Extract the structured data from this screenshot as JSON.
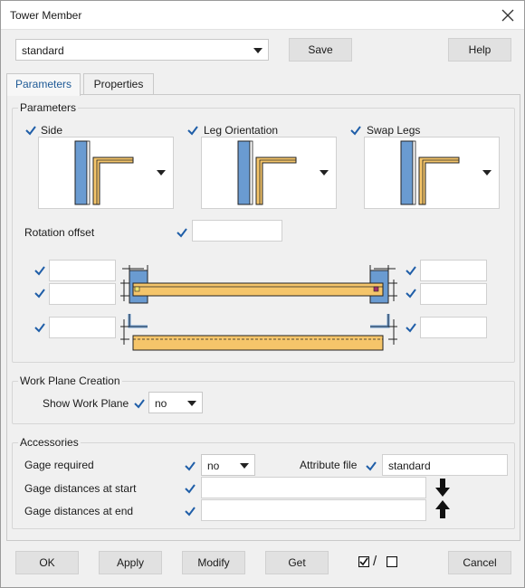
{
  "window": {
    "title": "Tower Member"
  },
  "toolbar": {
    "preset_value": "standard",
    "save_label": "Save",
    "help_label": "Help"
  },
  "tabs": [
    {
      "label": "Parameters"
    },
    {
      "label": "Properties"
    }
  ],
  "parameters": {
    "group_label": "Parameters",
    "side_label": "Side",
    "leg_orientation_label": "Leg Orientation",
    "swap_legs_label": "Swap Legs",
    "rotation_offset_label": "Rotation offset",
    "rotation_offset_value": ""
  },
  "work_plane": {
    "group_label": "Work Plane Creation",
    "show_label": "Show Work Plane",
    "show_value": "no"
  },
  "accessories": {
    "group_label": "Accessories",
    "gage_required_label": "Gage required",
    "gage_required_value": "no",
    "attribute_file_label": "Attribute file",
    "attribute_file_value": "standard",
    "gage_start_label": "Gage distances at start",
    "gage_start_value": "",
    "gage_end_label": "Gage distances at end",
    "gage_end_value": ""
  },
  "footer": {
    "ok_label": "OK",
    "apply_label": "Apply",
    "modify_label": "Modify",
    "get_label": "Get",
    "toggle_separator": "/",
    "cancel_label": "Cancel"
  },
  "colors": {
    "accent_blue": "#1e5a96",
    "check_blue": "#1f5ea8",
    "plate_blue": "#6a9bd1",
    "angle_yellow": "#f5c56a"
  }
}
